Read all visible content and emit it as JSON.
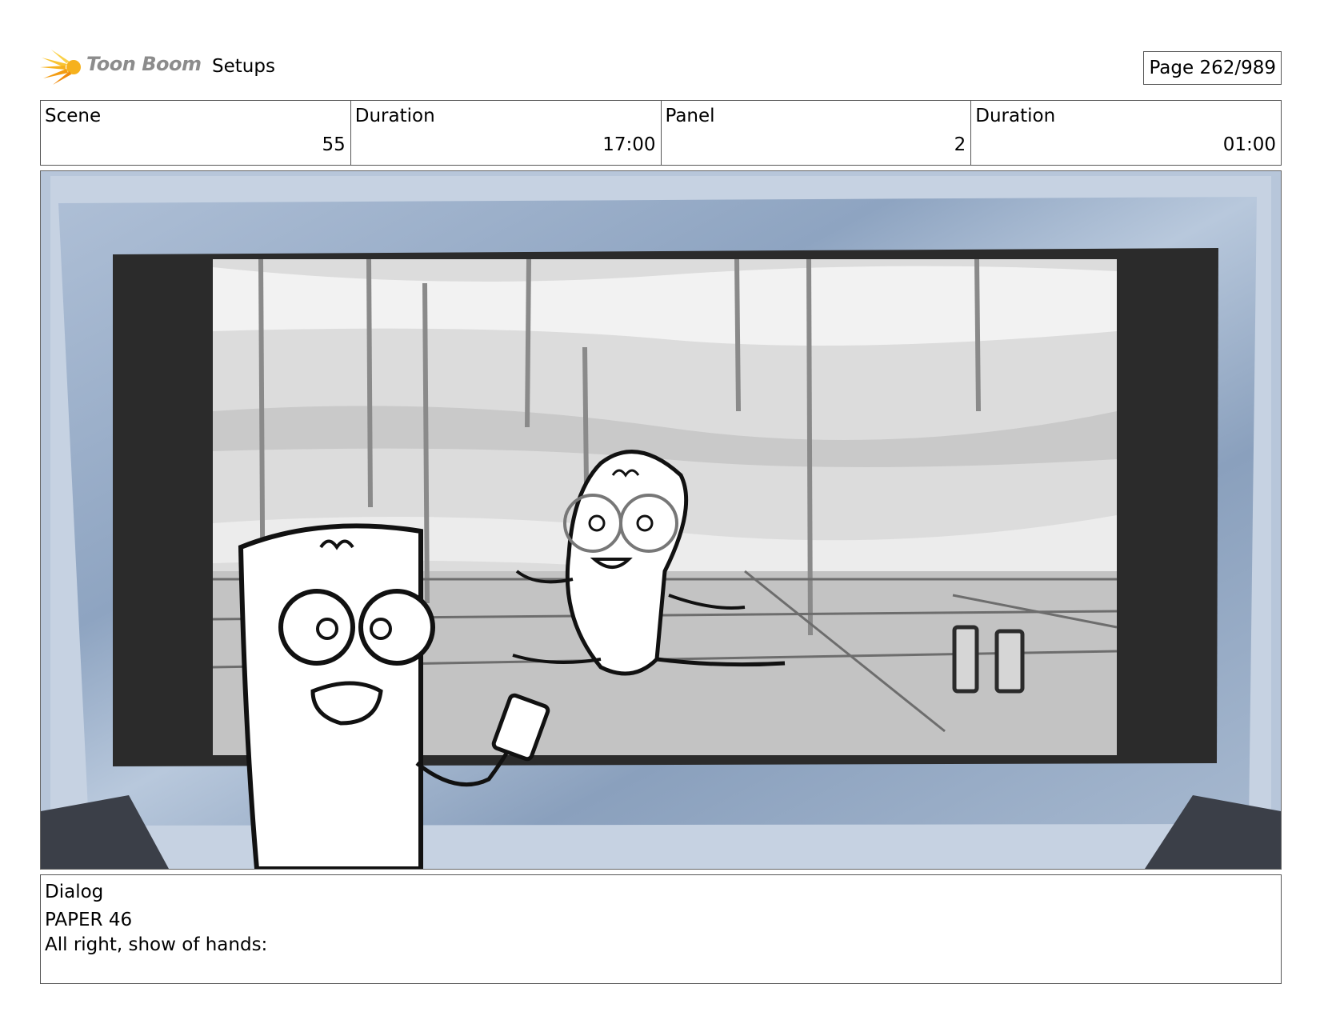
{
  "header": {
    "logo_text": "Toon Boom",
    "title": "Setups",
    "page_label": "Page 262/989"
  },
  "info": {
    "scene_label": "Scene",
    "scene_value": "55",
    "scene_duration_label": "Duration",
    "scene_duration_value": "17:00",
    "panel_label": "Panel",
    "panel_value": "2",
    "panel_duration_label": "Duration",
    "panel_duration_value": "01:00"
  },
  "dialog": {
    "label": "Dialog",
    "speaker": "PAPER 46",
    "line": "All right, show of hands:"
  },
  "colors": {
    "tv_frame": "#9fb3cc",
    "screen_bezel": "#2b2b2b",
    "logo_orange": "#f6b11d"
  },
  "icons": {
    "logo": "sun-burst-icon"
  }
}
